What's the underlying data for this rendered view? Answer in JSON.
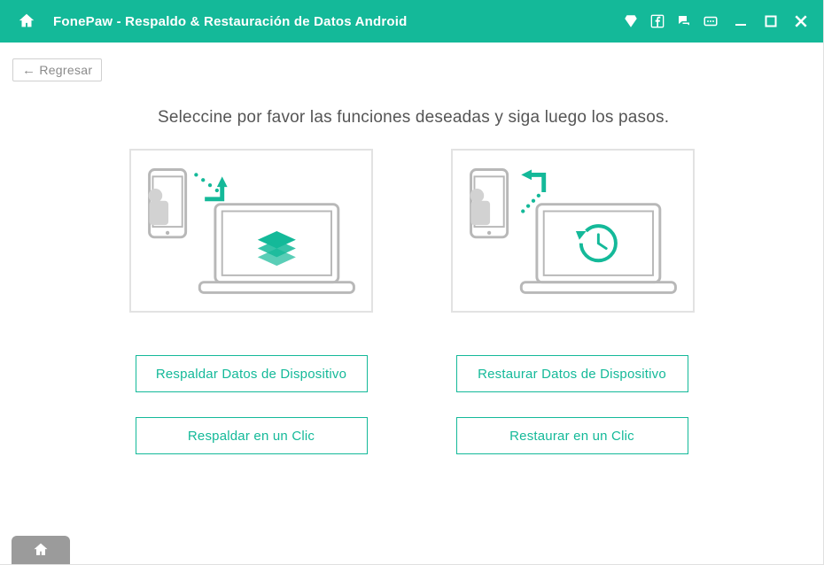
{
  "colors": {
    "accent": "#14b999",
    "muted": "#9b9b9b"
  },
  "titlebar": {
    "title": "FonePaw -  Respaldo & Restauración de Datos Android",
    "icons": {
      "diamond": "diamond-icon",
      "facebook": "facebook-icon",
      "chat": "chat-icon",
      "more": "more-icon"
    }
  },
  "back_label": "Regresar",
  "headline": "Seleccine por favor las funciones deseadas y siga luego los pasos.",
  "actions": {
    "backup_device": "Respaldar Datos de Dispositivo",
    "backup_one_click": "Respaldar en un Clic",
    "restore_device": "Restaurar Datos de Dispositivo",
    "restore_one_click": "Restaurar en un Clic"
  }
}
